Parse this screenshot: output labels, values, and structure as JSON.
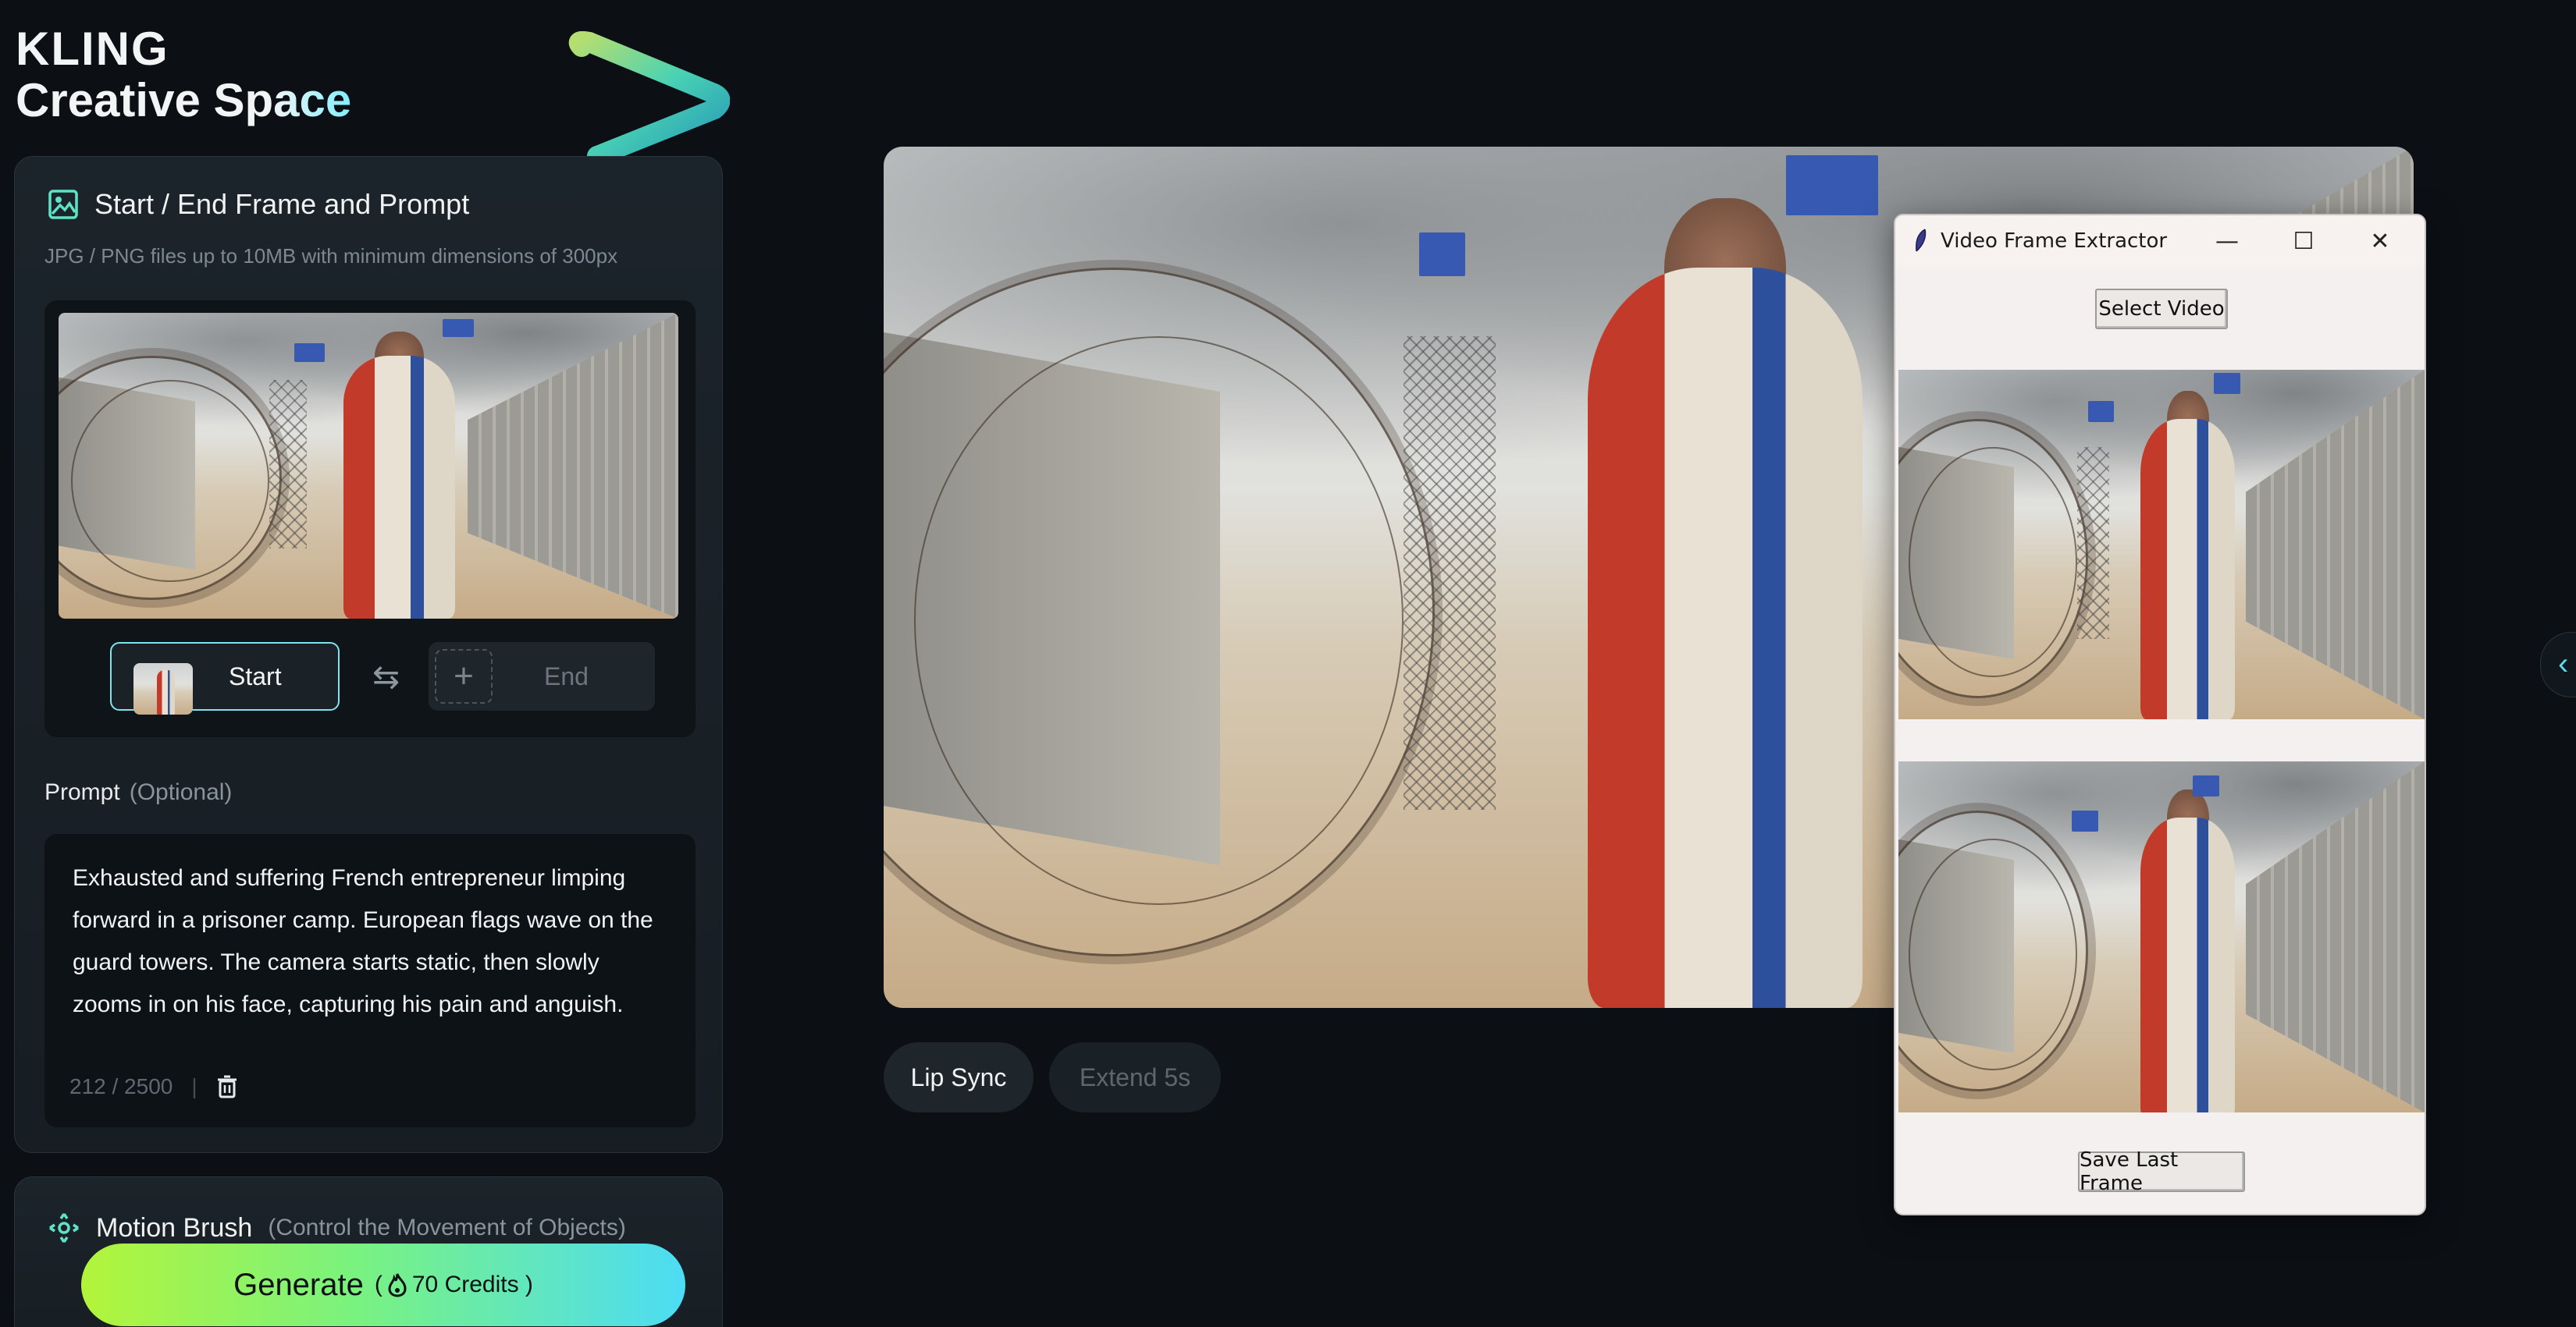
{
  "brand": {
    "line1": "KLING",
    "line2a": "Creative Sp",
    "line2b": "ace"
  },
  "frame_panel": {
    "title": "Start / End Frame and Prompt",
    "subtitle": "JPG / PNG files up to 10MB with minimum dimensions of 300px",
    "start_label": "Start",
    "end_label": "End",
    "swap_glyph": "⇆",
    "plus_glyph": "+"
  },
  "prompt": {
    "label": "Prompt",
    "optional": "(Optional)",
    "text": "Exhausted and suffering French entrepreneur limping forward in a prisoner camp. European flags wave on the guard towers. The camera starts static, then slowly zooms in on his face, capturing his pain and anguish.",
    "counter": "212 / 2500",
    "separator": "|"
  },
  "motion_brush": {
    "title": "Motion Brush",
    "subtitle": "(Control the Movement of Objects)"
  },
  "generate": {
    "label": "Generate",
    "credits_open": "(",
    "credits": "70 Credits )"
  },
  "preview_actions": {
    "lip_sync": "Lip Sync",
    "extend": "Extend 5s"
  },
  "side_toggle": {
    "glyph": "‹"
  },
  "extractor": {
    "title": "Video Frame Extractor",
    "minimize": "—",
    "maximize": "☐",
    "close": "✕",
    "select_video": "Select Video",
    "save_last_frame": "Save Last Frame"
  },
  "icons": {
    "frame_icon": "image-icon",
    "motion_icon": "motion-target-icon",
    "flame_icon": "flame-icon",
    "trash_icon": "trash-icon",
    "feather_icon": "feather-icon"
  },
  "colors": {
    "accent_cyan": "#7fe3f0",
    "generate_start": "#b3f43a",
    "generate_end": "#4cdcf5",
    "background": "#0c1015"
  }
}
